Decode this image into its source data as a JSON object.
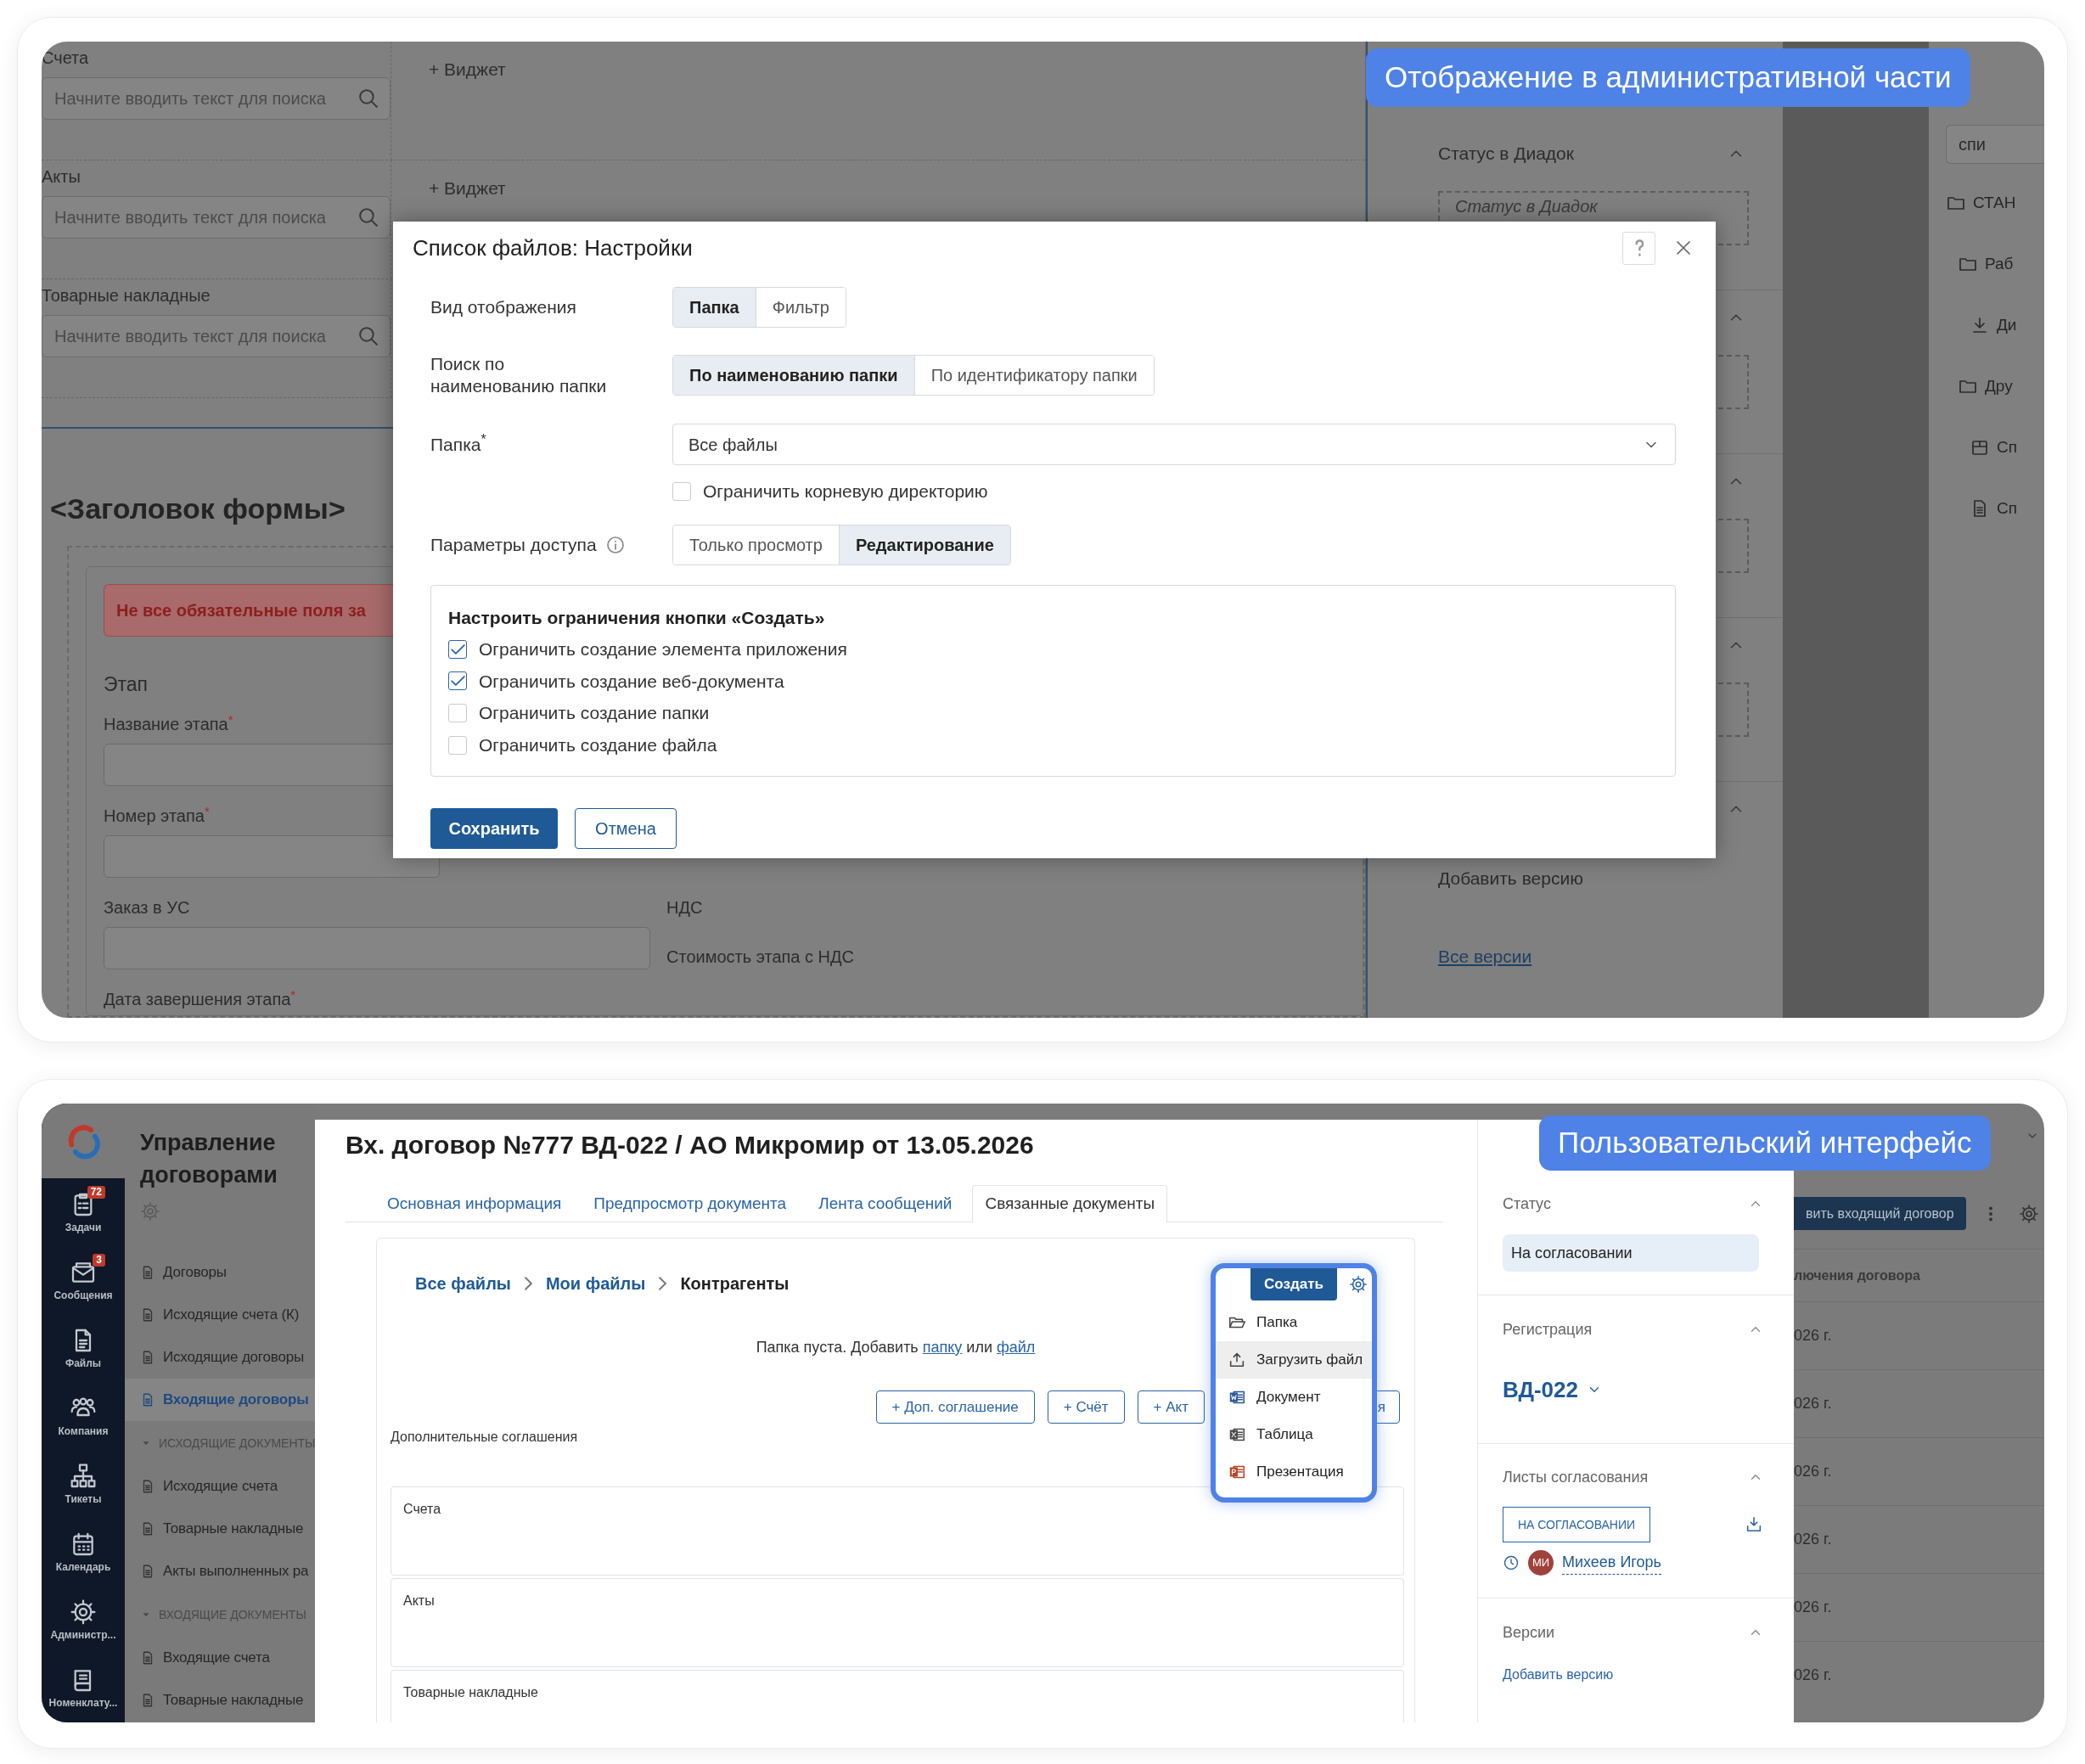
{
  "admin_view": {
    "callout": "Отображение в административной части",
    "widgets": [
      {
        "label": "Счета",
        "placeholder": "Начните вводить текст для поиска",
        "add_widget": "+ Виджет"
      },
      {
        "label": "Акты",
        "placeholder": "Начните вводить текст для поиска",
        "add_widget": "+ Виджет"
      },
      {
        "label": "Товарные накладные",
        "placeholder": "Начните вводить текст для поиска"
      }
    ],
    "form": {
      "title": "<Заголовок формы>",
      "error": "Не все обязательные поля за",
      "section": "Этап",
      "fields": [
        {
          "kind": "short",
          "label": "Название этапа$^{*}$"
        },
        {
          "kind": "short",
          "label": "Номер этапа$^{*}$"
        },
        {
          "kind": "wide",
          "label": "Заказ в УС"
        },
        {
          "kind": "label_only",
          "label": "Дата завершения этапа$^{*}$"
        }
      ],
      "side_labels": [
        "НДС",
        "Стоимость этапа с НДС"
      ]
    },
    "side_sections": [
      {
        "title": "Статус в Диадок",
        "slot": "Статус в Диадок",
        "expanded": true
      },
      {
        "expanded": true
      },
      {
        "expanded": true
      },
      {
        "expanded": true
      }
    ],
    "versions": {
      "expanded": true,
      "add": "Добавить версию",
      "all": "Все версии"
    },
    "tree": {
      "search": "спи",
      "items": [
        {
          "kind": "folder",
          "label": "СТАН",
          "children": [
            {
              "kind": "folder",
              "label": "Раб",
              "children": [
                {
                  "kind": "download",
                  "label": "Ди"
                }
              ]
            },
            {
              "kind": "folder",
              "label": "Дру",
              "children": [
                {
                  "kind": "box",
                  "label": "Сп"
                },
                {
                  "kind": "document",
                  "label": "Сп"
                }
              ]
            }
          ]
        }
      ]
    },
    "dialog": {
      "title": "Список файлов: Настройки",
      "display_mode": {
        "label": "Вид отображения",
        "options": [
          {
            "label": "Папка",
            "selected": true
          },
          {
            "label": "Фильтр",
            "selected": false
          }
        ]
      },
      "search_by": {
        "label": "Поиск по\nнаименованию папки",
        "options": [
          {
            "label": "По наименованию папки",
            "selected": true
          },
          {
            "label": "По идентификатору папки",
            "selected": false
          }
        ]
      },
      "folder": {
        "label": "Папка$^{*}$",
        "value": "Все файлы"
      },
      "restrict_root": {
        "label": "Ограничить корневую директорию",
        "checked": false
      },
      "access": {
        "label": "Параметры доступа",
        "options": [
          {
            "label": "Только просмотр",
            "selected": false
          },
          {
            "label": "Редактирование",
            "selected": true
          }
        ]
      },
      "create_limits": {
        "title": "Настроить ограничения кнопки «Создать»",
        "options": [
          {
            "label": "Ограничить создание элемента приложения",
            "checked": true
          },
          {
            "label": "Ограничить создание веб-документа",
            "checked": true
          },
          {
            "label": "Ограничить создание папки",
            "checked": false
          },
          {
            "label": "Ограничить создание файла",
            "checked": false
          }
        ]
      },
      "save": "Сохранить",
      "cancel": "Отмена"
    }
  },
  "user_view": {
    "callout": "Пользовательский интерфейс",
    "nav": [
      {
        "kind": "tasks",
        "label": "Задачи",
        "badge": "72"
      },
      {
        "kind": "messages",
        "label": "Сообщения",
        "badge": "3"
      },
      {
        "kind": "files",
        "label": "Файлы"
      },
      {
        "kind": "company",
        "label": "Компания"
      },
      {
        "kind": "tickets",
        "label": "Тикеты"
      },
      {
        "kind": "calendar",
        "label": "Календарь"
      },
      {
        "kind": "admin",
        "label": "Администр..."
      },
      {
        "kind": "catalog",
        "label": "Номенклату..."
      }
    ],
    "sidebar": {
      "title": "Управление договорами",
      "items": [
        {
          "label": "Договоры",
          "selected": false
        },
        {
          "label": "Исходящие счета (К)",
          "selected": false
        },
        {
          "label": "Исходящие договоры",
          "selected": false
        },
        {
          "label": "Входящие договоры",
          "selected": true
        }
      ],
      "sections": [
        {
          "title": "ИСХОДЯЩИЕ ДОКУМЕНТЫ",
          "expanded": true,
          "children": [
            {
              "label": "Исходящие счета",
              "selected": false
            },
            {
              "label": "Товарные накладные",
              "selected": false
            },
            {
              "label": "Акты выполненных ра",
              "selected": false
            }
          ]
        },
        {
          "title": "ВХОДЯЩИЕ ДОКУМЕНТЫ",
          "expanded": true,
          "children": [
            {
              "label": "Входящие счета",
              "selected": false
            },
            {
              "label": "Товарные накладные",
              "selected": false
            }
          ]
        }
      ]
    },
    "document": {
      "title": "Вх. договор №777 ВД-022 / АО Микромир от 13.05.2026",
      "tabs": [
        {
          "label": "Основная информация",
          "selected": false
        },
        {
          "label": "Предпросмотр документа",
          "selected": false
        },
        {
          "label": "Лента сообщений",
          "selected": false
        },
        {
          "label": "Связанные документы",
          "selected": true
        }
      ],
      "breadcrumb": [
        "Все файлы",
        "Мои файлы",
        "Контрагенты"
      ],
      "empty_message": {
        "text": "Папка пуста. Добавить",
        "folder_link": "папку",
        "joiner": "или",
        "file_link": "файл"
      },
      "add_buttons": [
        "+ Доп. соглашение",
        "+ Счёт",
        "+ Акт",
        "я"
      ],
      "agreements_label": "Дополнительные соглашения",
      "groups": [
        "Счета",
        "Акты",
        "Товарные накладные"
      ]
    },
    "create_menu": {
      "button": "Создать",
      "items": [
        {
          "kind": "folder",
          "label": "Папка",
          "selected": false
        },
        {
          "kind": "upload",
          "label": "Загрузить файл",
          "selected": true
        },
        {
          "kind": "word",
          "label": "Документ",
          "selected": false
        },
        {
          "kind": "excel",
          "label": "Таблица",
          "selected": false
        },
        {
          "kind": "powerpoint",
          "label": "Презентация",
          "selected": false
        }
      ]
    },
    "details": {
      "status": {
        "title": "Статус",
        "value": "На согласовании"
      },
      "registration": {
        "title": "Регистрация",
        "number": "ВД-022"
      },
      "approval": {
        "title": "Листы согласования",
        "badge": "НА СОГЛАСОВАНИИ",
        "initials": "МИ",
        "user": "Михеев Игорь"
      },
      "versions": {
        "title": "Версии",
        "add": "Добавить версию"
      }
    },
    "background_list": {
      "action": "вить входящий договор",
      "column": "лючения договора",
      "rows": [
        "026 г.",
        "026 г.",
        "026 г.",
        "026 г.",
        "026 г.",
        "026 г."
      ]
    }
  }
}
